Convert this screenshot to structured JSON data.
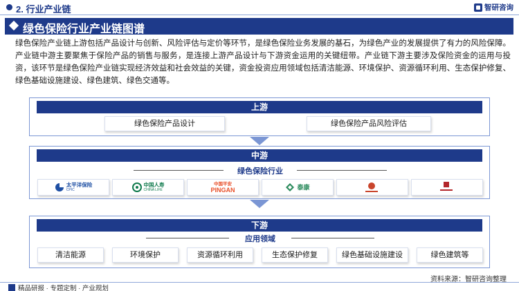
{
  "header": {
    "section_title": "2. 行业产业链",
    "brand": "智研咨询"
  },
  "title": "绿色保险行业产业链图谱",
  "intro": "绿色保险产业链上游包括产品设计与创新、风险评估与定价等环节，是绿色保险业务发展的基石，为绿色产业的发展提供了有力的风险保障。产业链中游主要聚焦于保险产品的销售与服务，是连接上游产品设计与下游资金运用的关键纽带。产业链下游主要涉及保险资金的运用与投资，该环节是绿色保险产业链实现经济效益和社会效益的关键，资金投资应用领域包括清洁能源、环境保护、资源循环利用、生态保护修复、绿色基础设施建设、绿色建筑、绿色交通等。",
  "upstream": {
    "label": "上游",
    "items": [
      "绿色保险产品设计",
      "绿色保险产品风险评估"
    ]
  },
  "midstream": {
    "label": "中游",
    "subheading": "绿色保险行业",
    "companies": [
      {
        "name": "太平洋保险",
        "sub": "CPIC",
        "color": "#1e4fa3",
        "icon": "cpic-logo-icon"
      },
      {
        "name": "中国人寿",
        "sub": "CHINA LIFE",
        "color": "#0f7a4c",
        "icon": "china-life-logo-icon"
      },
      {
        "name": "中国平安",
        "sub": "PINGAN",
        "color": "#e8502a",
        "icon": "pingan-logo-icon"
      },
      {
        "name": "泰康",
        "sub": "",
        "color": "#2c8b5d",
        "icon": "taikang-logo-icon"
      },
      {
        "name": "",
        "sub": "",
        "color": "#c9452c",
        "icon": "insurer-logo-icon"
      },
      {
        "name": "",
        "sub": "",
        "color": "#b3262a",
        "icon": "picc-logo-icon"
      }
    ]
  },
  "downstream": {
    "label": "下游",
    "subheading": "应用领域",
    "items": [
      "清洁能源",
      "环境保护",
      "资源循环利用",
      "生态保护修复",
      "绿色基础设施建设",
      "绿色建筑等"
    ]
  },
  "source": "资料来源：智研咨询整理",
  "footer": "精品研报 · 专题定制 · 产业规划",
  "colors": {
    "primary": "#1e3a8a",
    "border": "#7b96d4"
  }
}
